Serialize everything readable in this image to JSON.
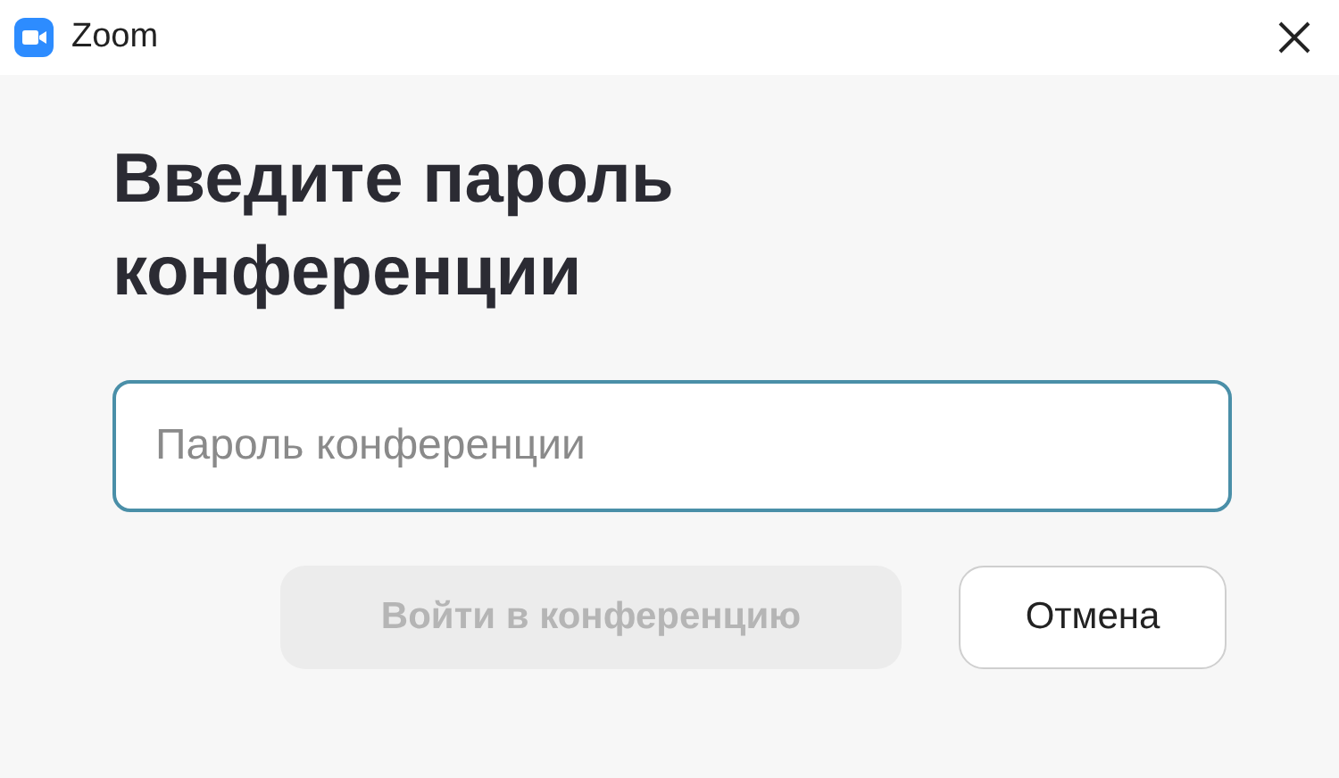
{
  "window": {
    "title": "Zoom"
  },
  "heading": "Введите пароль конференции",
  "password_field": {
    "placeholder": "Пароль конференции"
  },
  "buttons": [
    {
      "label": "Войти в конференцию",
      "disabled": true,
      "kind": "primary"
    },
    {
      "label": "Отмена",
      "disabled": false,
      "kind": "secondary"
    }
  ]
}
